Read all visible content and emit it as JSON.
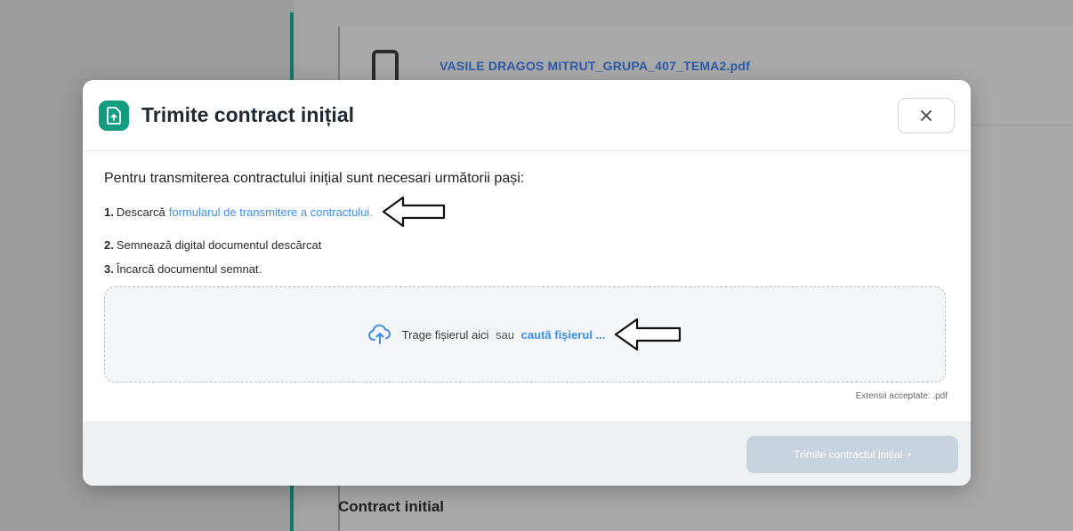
{
  "background": {
    "file_name": "VASILE DRAGOS MITRUT_GRUPA_407_TEMA2.pdf",
    "section_label": "Contract initial"
  },
  "modal": {
    "title": "Trimite contract inițial",
    "close_icon": "close-icon",
    "intro": "Pentru transmiterea contractului inițial sunt necesari următorii pași:",
    "steps": [
      {
        "num": "1.",
        "text": "Descarcă",
        "link": "formularul de transmitere a contractului."
      },
      {
        "num": "2.",
        "text": "Semnează digital documentul descărcat"
      },
      {
        "num": "3.",
        "text": "Încarcă documentul semnat."
      }
    ],
    "dropzone": {
      "text": "Trage fișierul aici",
      "or": "sau",
      "link": "caută fișierul ..."
    },
    "accepted": "Extensii acceptate: .pdf",
    "submit_label": "Trimite contractul inițial"
  },
  "colors": {
    "accent": "#139c7f",
    "link": "#3d8ee6",
    "submit_disabled": "#c9d3df"
  }
}
